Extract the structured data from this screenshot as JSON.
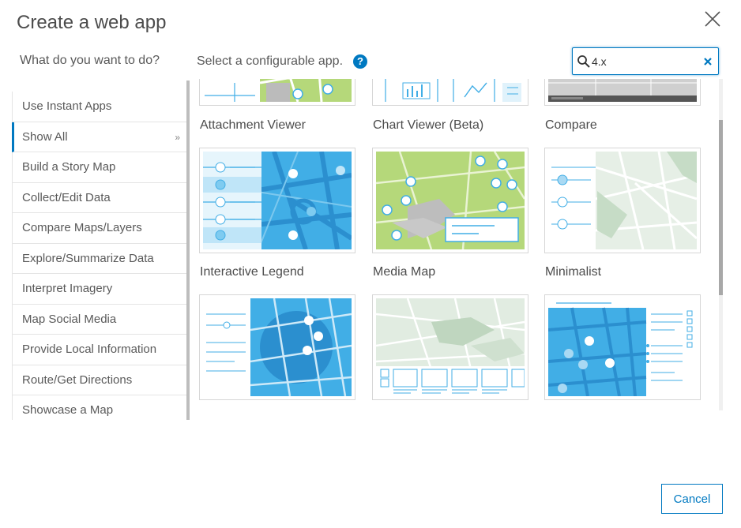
{
  "dialog": {
    "title": "Create a web app",
    "cancel_label": "Cancel"
  },
  "left": {
    "question": "What do you want to do?"
  },
  "right": {
    "prompt": "Select a configurable app.",
    "help_glyph": "?"
  },
  "search": {
    "value": "4.x",
    "placeholder": ""
  },
  "nav": {
    "items": [
      {
        "label": "Use Instant Apps",
        "active": false
      },
      {
        "label": "Show All",
        "active": true,
        "chevron": "»"
      },
      {
        "label": "Build a Story Map",
        "active": false
      },
      {
        "label": "Collect/Edit Data",
        "active": false
      },
      {
        "label": "Compare Maps/Layers",
        "active": false
      },
      {
        "label": "Explore/Summarize Data",
        "active": false
      },
      {
        "label": "Interpret Imagery",
        "active": false
      },
      {
        "label": "Map Social Media",
        "active": false
      },
      {
        "label": "Provide Local Information",
        "active": false
      },
      {
        "label": "Route/Get Directions",
        "active": false
      },
      {
        "label": "Showcase a Map",
        "active": false
      }
    ]
  },
  "apps": [
    {
      "title": "Attachment Viewer"
    },
    {
      "title": "Chart Viewer (Beta)"
    },
    {
      "title": "Compare"
    },
    {
      "title": "Interactive Legend"
    },
    {
      "title": "Media Map"
    },
    {
      "title": "Minimalist"
    },
    {
      "title": ""
    },
    {
      "title": ""
    },
    {
      "title": ""
    }
  ],
  "icons": {
    "close": "close-icon",
    "search": "search-icon",
    "clear": "clear-icon",
    "help": "help-icon"
  },
  "colors": {
    "accent": "#0079c1",
    "map_blue": "#41aee6",
    "map_green": "#b5d87a",
    "text": "#4c4c4c"
  }
}
